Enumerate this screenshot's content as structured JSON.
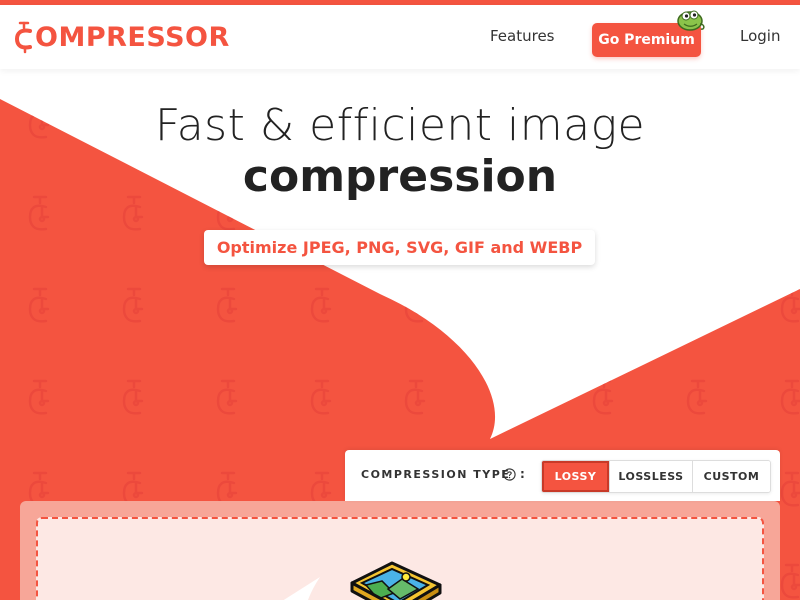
{
  "header": {
    "logo_text": "OMPRESSOR",
    "logo_icon": "c-clamp-icon",
    "nav": {
      "features": "Features",
      "premium": "Go Premium",
      "login": "Login"
    },
    "mascot_icon": "chameleon-icon"
  },
  "hero": {
    "title_line1": "Fast & efficient image",
    "title_line2": "compression",
    "tagline": "Optimize JPEG, PNG, SVG, GIF and WEBP"
  },
  "compression": {
    "label": "COMPRESSION TYPE",
    "help_icon": "question-circle-icon",
    "colon": ":",
    "options": [
      {
        "label": "LOSSY",
        "selected": true
      },
      {
        "label": "LOSSLESS",
        "selected": false
      },
      {
        "label": "CUSTOM",
        "selected": false
      }
    ]
  },
  "dropzone": {
    "icon": "image-upload-icon"
  },
  "colors": {
    "brand": "#f45440",
    "dark_text": "#222222",
    "dropzone_bg": "#fde8e4",
    "dropzone_frame": "#f7a698"
  }
}
